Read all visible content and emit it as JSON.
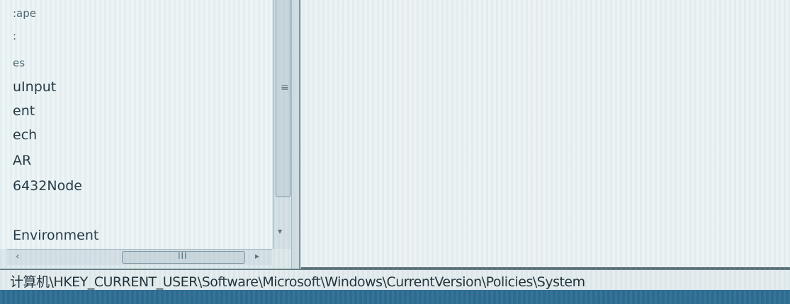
{
  "tree": {
    "items": [
      {
        "label": ":ape",
        "faint": true
      },
      {
        "label": ":",
        "faint": true
      },
      {
        "label": "es",
        "faint": true
      },
      {
        "label": "uInput",
        "faint": false
      },
      {
        "label": "ent",
        "faint": false
      },
      {
        "label": "ech",
        "faint": false
      },
      {
        "label": "AR",
        "faint": false
      },
      {
        "label": "6432Node",
        "faint": false
      },
      {
        "label": "Environment",
        "faint": false
      }
    ]
  },
  "scrollbars": {
    "vertical_grip": "≡",
    "vertical_down": "▾",
    "horizontal_left": "‹",
    "horizontal_grip": "III",
    "horizontal_right": "▸"
  },
  "status_bar": {
    "path": "计算机\\HKEY_CURRENT_USER\\Software\\Microsoft\\Windows\\CurrentVersion\\Policies\\System"
  },
  "colors": {
    "accent": "#2f6b90",
    "pane_bg": "#edf2f2"
  }
}
